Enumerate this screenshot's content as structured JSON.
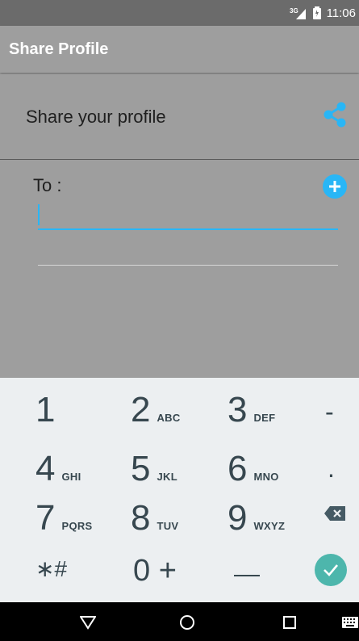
{
  "status_bar": {
    "network": "3G",
    "time": "11:06"
  },
  "app_bar": {
    "title": "Share Profile"
  },
  "share_row": {
    "label": "Share your profile",
    "icon": "share-icon"
  },
  "recipient": {
    "label": "To :",
    "value": "",
    "add_icon": "add-circle-icon"
  },
  "keypad": {
    "rows": [
      [
        {
          "num": "1",
          "letters": ""
        },
        {
          "num": "2",
          "letters": "ABC"
        },
        {
          "num": "3",
          "letters": "DEF"
        },
        {
          "sym": "-"
        }
      ],
      [
        {
          "num": "4",
          "letters": "GHI"
        },
        {
          "num": "5",
          "letters": "JKL"
        },
        {
          "num": "6",
          "letters": "MNO"
        },
        {
          "sym": "."
        }
      ],
      [
        {
          "num": "7",
          "letters": "PQRS"
        },
        {
          "num": "8",
          "letters": "TUV"
        },
        {
          "num": "9",
          "letters": "WXYZ"
        },
        {
          "sym": "backspace-icon"
        }
      ],
      [
        {
          "sym": "*#"
        },
        {
          "num": "0 +",
          "letters": ""
        },
        {
          "sym": "space"
        },
        {
          "sym": "done-check-icon"
        }
      ]
    ],
    "star_hash": "∗#",
    "zero_plus": "0 +",
    "dash": "-",
    "dot": ".",
    "accent_done": "#4db6ac"
  },
  "nav_bar": {
    "back_icon": "back-triangle-icon",
    "home_icon": "home-circle-icon",
    "recents_icon": "recents-square-icon",
    "keyboard_icon": "keyboard-icon"
  },
  "colors": {
    "accent": "#29b6f6",
    "background": "#9e9e9e",
    "keypad": "#eceff1"
  }
}
